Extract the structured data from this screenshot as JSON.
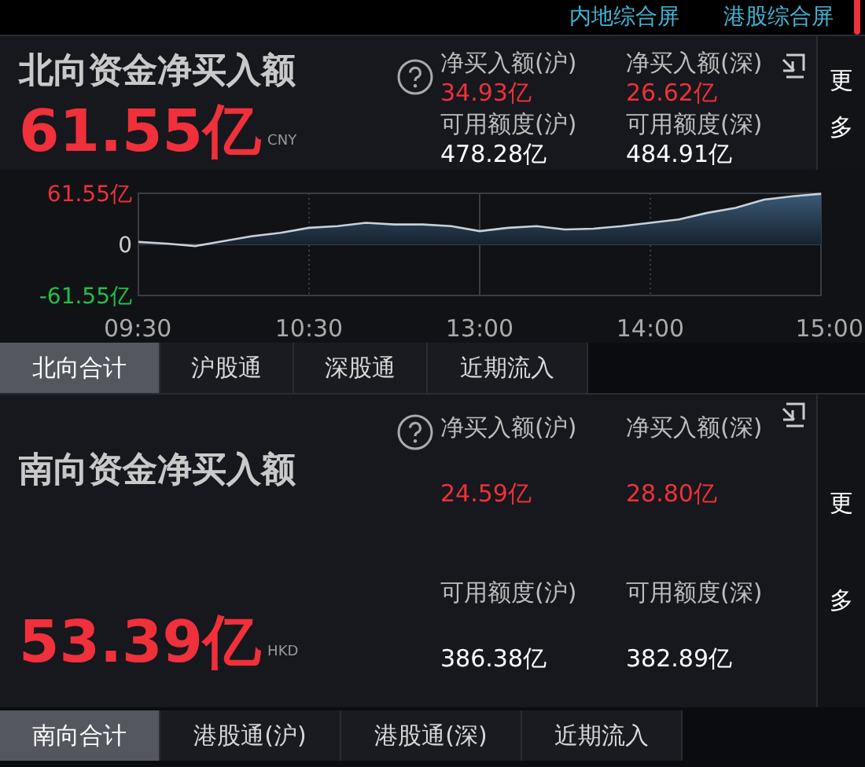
{
  "top_links": [
    {
      "label": "内地综合屏"
    },
    {
      "label": "港股综合屏"
    }
  ],
  "north": {
    "title": "北向资金净买入额",
    "amount": "61.55亿",
    "currency": "CNY",
    "stats": [
      {
        "label": "净买入额(沪)",
        "value": "34.93亿",
        "kind": "flow"
      },
      {
        "label": "净买入额(深)",
        "value": "26.62亿",
        "kind": "flow"
      },
      {
        "label": "可用额度(沪)",
        "value": "478.28亿",
        "kind": "quota"
      },
      {
        "label": "可用额度(深)",
        "value": "484.91亿",
        "kind": "quota"
      }
    ],
    "more": [
      "更",
      "多"
    ],
    "chart_data": {
      "type": "area",
      "categories": [
        "09:30",
        null,
        null,
        null,
        null,
        null,
        "10:30",
        null,
        null,
        null,
        null,
        null,
        "13:00",
        null,
        null,
        null,
        null,
        null,
        "14:00",
        null,
        null,
        null,
        null,
        null,
        "15:00"
      ],
      "series": [
        {
          "color": "#c8d0d8",
          "values": [
            3,
            1,
            -2,
            4,
            10,
            14,
            20,
            22,
            26,
            24,
            24,
            22,
            16,
            20,
            22,
            18,
            19,
            22,
            26,
            30,
            38,
            44,
            54,
            58,
            61
          ]
        }
      ],
      "ylim": [
        -61.55,
        61.55
      ],
      "grid": true,
      "yticks": [
        {
          "value": 61.55,
          "label": "61.55亿"
        },
        {
          "value": 0,
          "label": "0"
        },
        {
          "value": -61.55,
          "label": "-61.55亿"
        }
      ]
    },
    "tabs": [
      {
        "label": "北向合计",
        "selected": true
      },
      {
        "label": "沪股通",
        "selected": false
      },
      {
        "label": "深股通",
        "selected": false
      },
      {
        "label": "近期流入",
        "selected": false
      }
    ]
  },
  "south": {
    "title": "南向资金净买入额",
    "amount": "53.39亿",
    "currency": "HKD",
    "stats": [
      {
        "label": "净买入额(沪)",
        "value": "24.59亿",
        "kind": "flow"
      },
      {
        "label": "净买入额(深)",
        "value": "28.80亿",
        "kind": "flow"
      },
      {
        "label": "可用额度(沪)",
        "value": "386.38亿",
        "kind": "quota"
      },
      {
        "label": "可用额度(深)",
        "value": "382.89亿",
        "kind": "quota"
      }
    ],
    "more": [
      "更",
      "多"
    ],
    "tabs": [
      {
        "label": "南向合计",
        "selected": true
      },
      {
        "label": "港股通(沪)",
        "selected": false
      },
      {
        "label": "港股通(深)",
        "selected": false
      },
      {
        "label": "近期流入",
        "selected": false
      }
    ]
  }
}
